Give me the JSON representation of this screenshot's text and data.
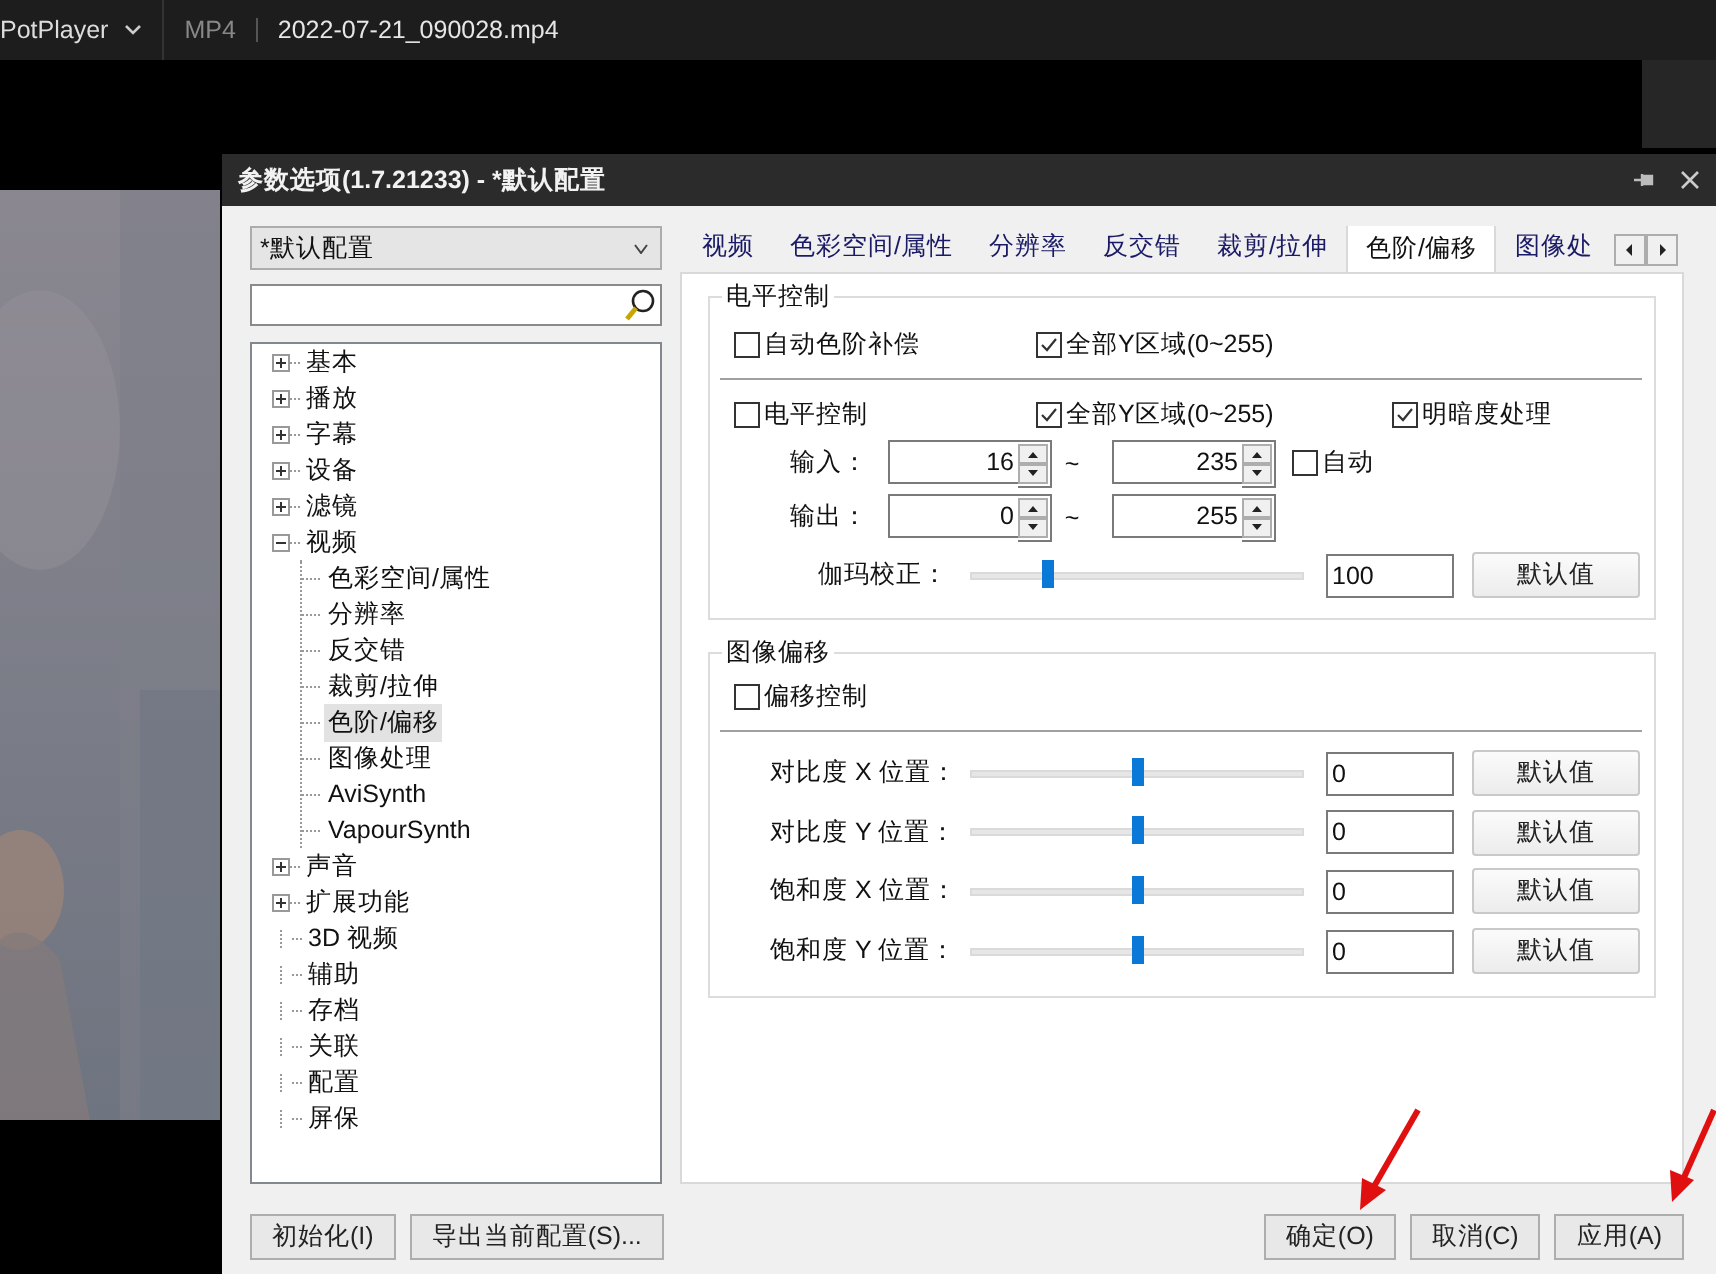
{
  "player_bar": {
    "app": "PotPlayer",
    "format": "MP4",
    "file": "2022-07-21_090028.mp4"
  },
  "dialog": {
    "title": "参数选项(1.7.21233) - *默认配置"
  },
  "profile_select": {
    "value": "*默认配置"
  },
  "tree": [
    {
      "label": "基本",
      "kind": "group",
      "expanded": false,
      "selected": false
    },
    {
      "label": "播放",
      "kind": "group",
      "expanded": false,
      "selected": false
    },
    {
      "label": "字幕",
      "kind": "group",
      "expanded": false,
      "selected": false
    },
    {
      "label": "设备",
      "kind": "group",
      "expanded": false,
      "selected": false
    },
    {
      "label": "滤镜",
      "kind": "group",
      "expanded": false,
      "selected": false
    },
    {
      "label": "视频",
      "kind": "group",
      "expanded": true,
      "selected": false,
      "children": [
        {
          "label": "色彩空间/属性",
          "selected": false
        },
        {
          "label": "分辨率",
          "selected": false
        },
        {
          "label": "反交错",
          "selected": false
        },
        {
          "label": "裁剪/拉伸",
          "selected": false
        },
        {
          "label": "色阶/偏移",
          "selected": true
        },
        {
          "label": "图像处理",
          "selected": false
        },
        {
          "label": "AviSynth",
          "selected": false
        },
        {
          "label": "VapourSynth",
          "selected": false
        }
      ]
    },
    {
      "label": "声音",
      "kind": "group",
      "expanded": false,
      "selected": false
    },
    {
      "label": "扩展功能",
      "kind": "group",
      "expanded": false,
      "selected": false
    },
    {
      "label": "3D 视频",
      "kind": "leaf",
      "selected": false
    },
    {
      "label": "辅助",
      "kind": "leaf",
      "selected": false
    },
    {
      "label": "存档",
      "kind": "leaf",
      "selected": false
    },
    {
      "label": "关联",
      "kind": "leaf",
      "selected": false
    },
    {
      "label": "配置",
      "kind": "leaf",
      "selected": false
    },
    {
      "label": "屏保",
      "kind": "leaf",
      "selected": false
    }
  ],
  "tabs": [
    {
      "label": "视频",
      "selected": false
    },
    {
      "label": "色彩空间/属性",
      "selected": false
    },
    {
      "label": "分辨率",
      "selected": false
    },
    {
      "label": "反交错",
      "selected": false
    },
    {
      "label": "裁剪/拉伸",
      "selected": false
    },
    {
      "label": "色阶/偏移",
      "selected": true
    },
    {
      "label": "图像处",
      "selected": false
    }
  ],
  "levels": {
    "title": "电平控制",
    "row1": [
      {
        "label": "自动色阶补偿",
        "checked": false
      },
      {
        "label": "全部Y区域(0~255)",
        "checked": true
      }
    ],
    "row2": [
      {
        "label": "电平控制",
        "checked": false
      },
      {
        "label": "全部Y区域(0~255)",
        "checked": true
      },
      {
        "label": "明暗度处理",
        "checked": true
      }
    ],
    "ranges": [
      {
        "label": "输入：",
        "from": "16",
        "separator": "~",
        "to": "235",
        "auto": {
          "label": "自动",
          "checked": false
        }
      },
      {
        "label": "输出：",
        "from": "0",
        "separator": "~",
        "to": "255"
      }
    ],
    "gamma": {
      "label": "伽玛校正：",
      "level": 0.23,
      "value": "100",
      "button": "默认值"
    }
  },
  "offset": {
    "title": "图像偏移",
    "control": {
      "label": "偏移控制",
      "checked": false
    },
    "sliders": [
      {
        "label": "对比度 X 位置：",
        "level": 0.5,
        "value": "0",
        "button": "默认值"
      },
      {
        "label": "对比度 Y 位置：",
        "level": 0.5,
        "value": "0",
        "button": "默认值"
      },
      {
        "label": "饱和度 X 位置：",
        "level": 0.5,
        "value": "0",
        "button": "默认值"
      },
      {
        "label": "饱和度 Y 位置：",
        "level": 0.5,
        "value": "0",
        "button": "默认值"
      }
    ]
  },
  "footer": {
    "left": [
      "初始化(I)",
      "导出当前配置(S)..."
    ],
    "right": [
      "确定(O)",
      "取消(C)",
      "应用(A)"
    ]
  }
}
